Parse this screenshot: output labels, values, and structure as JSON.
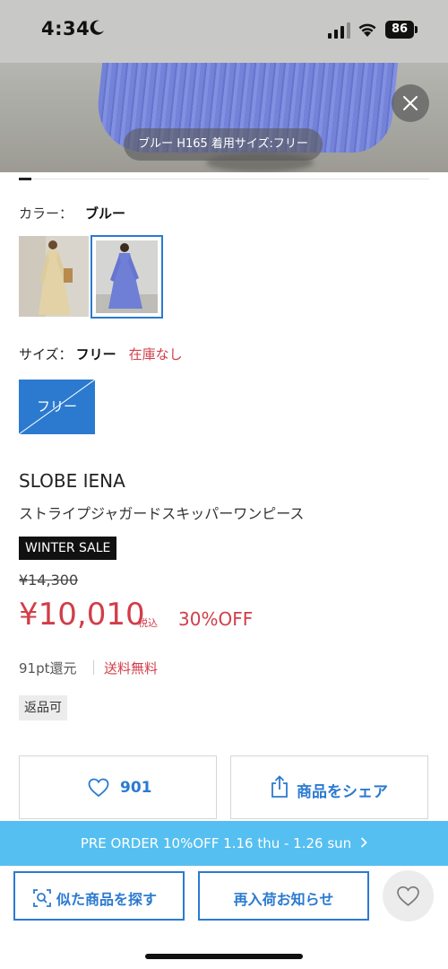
{
  "status_bar": {
    "time": "4:34",
    "battery": "86"
  },
  "hero": {
    "caption": "ブルー H165 着用サイズ:フリー",
    "close_icon": "close-icon"
  },
  "color": {
    "label": "カラー：",
    "value": "ブルー",
    "swatches": [
      "beige",
      "blue"
    ]
  },
  "size": {
    "label": "サイズ：",
    "value": "フリー",
    "stock": "在庫なし",
    "button_label": "フリー"
  },
  "product": {
    "brand": "SLOBE IENA",
    "name": "ストライプジャガードスキッパーワンピース",
    "sale_badge": "WINTER SALE",
    "original_price": "¥14,300",
    "sale_price": "¥10,010",
    "tax_label": "税込",
    "discount": "30%OFF",
    "points": "91pt還元",
    "shipping": "送料無料",
    "returnable": "返品可"
  },
  "actions": {
    "favorite_count": "901",
    "share_label": "商品をシェア"
  },
  "banner": {
    "text": "PRE ORDER 10%OFF 1.16 thu - 1.26 sun"
  },
  "bottom_bar": {
    "similar_label": "似た商品を探す",
    "restock_label": "再入荷お知らせ"
  },
  "colors": {
    "accent_blue": "#2b7ad0",
    "sale_red": "#d23d48",
    "banner_blue": "#55bff1"
  }
}
